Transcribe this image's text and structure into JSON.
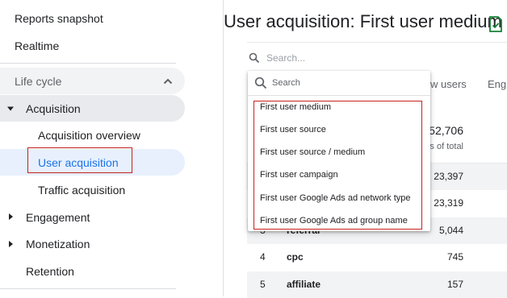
{
  "sidebar": {
    "reports_snapshot": "Reports snapshot",
    "realtime": "Realtime",
    "lifecycle": "Life cycle",
    "acquisition": "Acquisition",
    "acquisition_overview": "Acquisition overview",
    "user_acquisition": "User acquisition",
    "traffic_acquisition": "Traffic acquisition",
    "engagement": "Engagement",
    "monetization": "Monetization",
    "retention": "Retention"
  },
  "main": {
    "title": "User acquisition: First user medium",
    "search_placeholder": "Search...",
    "columns": {
      "new_users": "w users",
      "engagement": "Eng"
    },
    "totals": {
      "new_users": "52,706",
      "caption": "s of total"
    },
    "rows": [
      {
        "index": "",
        "medium": "",
        "new_users": "23,397"
      },
      {
        "index": "",
        "medium": "",
        "new_users": "23,319"
      },
      {
        "index": "3",
        "medium": "referral",
        "new_users": "5,044"
      },
      {
        "index": "4",
        "medium": "cpc",
        "new_users": "745"
      },
      {
        "index": "5",
        "medium": "affiliate",
        "new_users": "157"
      }
    ]
  },
  "dropdown": {
    "search_placeholder": "Search",
    "options": [
      "First user medium",
      "First user source",
      "First user source / medium",
      "First user campaign",
      "First user Google Ads ad network type",
      "First user Google Ads ad group name"
    ]
  },
  "colors": {
    "accent": "#1a73e8",
    "highlight_border": "#c5221f",
    "report_icon": "#188038"
  },
  "icons": {
    "collapse": "chevron-up-icon",
    "expand": "caret-down-icon",
    "collapsed": "caret-right-icon",
    "search": "search-icon",
    "report": "report-check-icon"
  }
}
